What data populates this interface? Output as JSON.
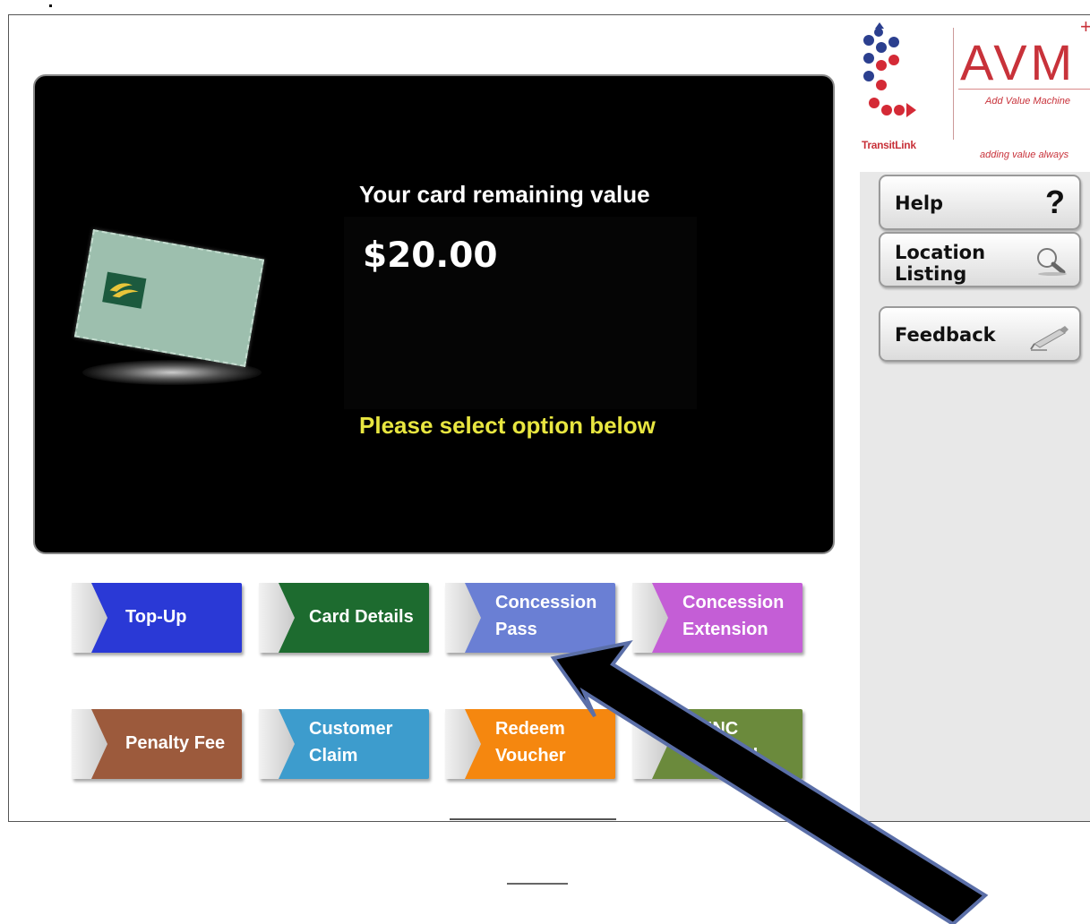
{
  "sidebar": {
    "logo": {
      "brand": "AVM",
      "subtitle": "Add Value Machine",
      "tagline": "adding value always",
      "operator": "TransitLink"
    },
    "buttons": [
      {
        "label_line1": "Help",
        "label_line2": "",
        "icon": "question-mark-icon",
        "glyph": "?"
      },
      {
        "label_line1": "Location",
        "label_line2": "Listing",
        "icon": "magnifier-icon"
      },
      {
        "label_line1": "Feedback",
        "label_line2": "",
        "icon": "pen-icon"
      }
    ]
  },
  "panel": {
    "title": "Your card remaining value",
    "value": "$20.00",
    "instruction": "Please select option below"
  },
  "options": [
    {
      "line1": "Top-Up",
      "line2": "",
      "color": "#2a39d6"
    },
    {
      "line1": "Card Details",
      "line2": "",
      "color": "#1d6b2f"
    },
    {
      "line1": "Concession",
      "line2": "Pass",
      "color": "#6a7fd4"
    },
    {
      "line1": "Concession",
      "line2": "Extension",
      "color": "#c45ed6"
    },
    {
      "line1": "Penalty Fee",
      "line2": "",
      "color": "#9c5a3c"
    },
    {
      "line1": "Customer",
      "line2": "Claim",
      "color": "#3d9ccd"
    },
    {
      "line1": "Redeem",
      "line2": "Voucher",
      "color": "#f5870f"
    },
    {
      "line1": "USINC",
      "line2": "d",
      "color": "#6b8a3c"
    }
  ],
  "colors": {
    "highlight_text": "#e8e640",
    "panel_bg": "#000000",
    "brand_red": "#c8323a"
  }
}
